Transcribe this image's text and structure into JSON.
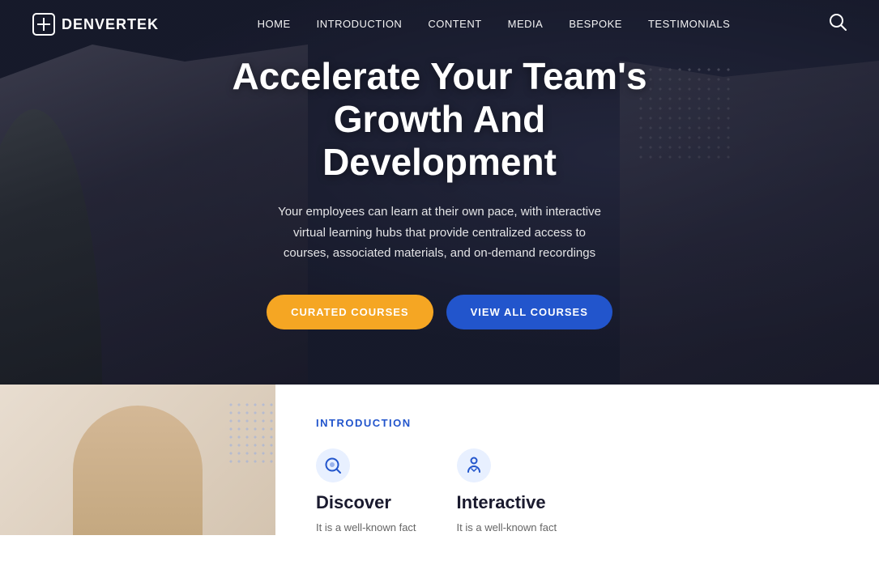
{
  "brand": {
    "name": "DENVERTEK",
    "logo_icon": "plus-square"
  },
  "nav": {
    "links": [
      {
        "label": "HOME",
        "href": "#"
      },
      {
        "label": "INTRODUCTION",
        "href": "#"
      },
      {
        "label": "CONTENT",
        "href": "#"
      },
      {
        "label": "MEDIA",
        "href": "#"
      },
      {
        "label": "BESPOKE",
        "href": "#"
      },
      {
        "label": "TESTIMONIALS",
        "href": "#"
      }
    ],
    "search_label": "Search"
  },
  "hero": {
    "title": "Accelerate Your Team's Growth And Development",
    "subtitle": "Your employees can learn at their own pace, with interactive virtual learning hubs that provide centralized access to courses, associated materials, and on-demand recordings",
    "btn_primary": "CURATED COURSES",
    "btn_secondary": "VIEW ALL COURSES"
  },
  "intro": {
    "section_label": "INTRODUCTION",
    "features": [
      {
        "icon": "🔍",
        "title": "Discover",
        "description": "It is a well-known fact"
      },
      {
        "icon": "📖",
        "title": "Interactive",
        "description": "It is a well-known fact"
      }
    ]
  },
  "colors": {
    "accent_yellow": "#f5a623",
    "accent_blue": "#2255cc",
    "nav_text": "#ffffff"
  }
}
